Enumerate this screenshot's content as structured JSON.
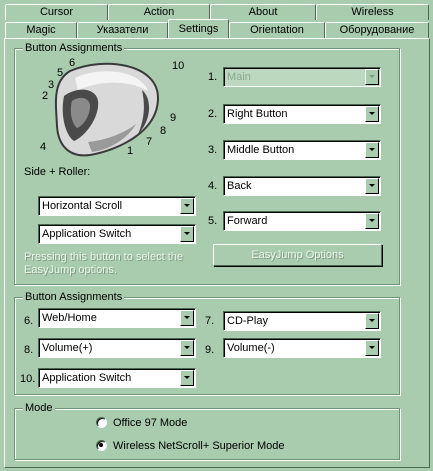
{
  "tabs_back": [
    {
      "id": "cursor",
      "label": "Cursor"
    },
    {
      "id": "action",
      "label": "Action"
    },
    {
      "id": "about",
      "label": "About"
    },
    {
      "id": "wireless",
      "label": "Wireless"
    }
  ],
  "tabs_front": [
    {
      "id": "magic",
      "label": "Magic"
    },
    {
      "id": "pointers",
      "label": "Указатели"
    },
    {
      "id": "settings",
      "label": "Settings",
      "active": true
    },
    {
      "id": "orientation",
      "label": "Orientation"
    },
    {
      "id": "hardware",
      "label": "Оборудование"
    }
  ],
  "main_group": {
    "title": "Button  Assignments",
    "callouts": [
      "1",
      "2",
      "3",
      "4",
      "5",
      "6",
      "7",
      "8",
      "9",
      "10"
    ],
    "assignments": [
      {
        "num": "1.",
        "value": "Main",
        "disabled": true
      },
      {
        "num": "2.",
        "value": "Right Button"
      },
      {
        "num": "3.",
        "value": "Middle Button"
      },
      {
        "num": "4.",
        "value": "Back"
      },
      {
        "num": "5.",
        "value": "Forward"
      }
    ],
    "side_roller_label": "Side + Roller:",
    "side_combo": "Horizontal Scroll",
    "roller_combo": "Application Switch",
    "easyjump_hint": "Pressing this button to select the EasyJump options.",
    "easyjump_button": "EasyJump Options"
  },
  "extra_group": {
    "title": "Button  Assignments",
    "assignments": [
      {
        "num": "6.",
        "value": "Web/Home"
      },
      {
        "num": "7.",
        "value": "CD-Play"
      },
      {
        "num": "8.",
        "value": "Volume(+)"
      },
      {
        "num": "9.",
        "value": "Volume(-)"
      },
      {
        "num": "10.",
        "value": "Application Switch"
      }
    ]
  },
  "mode_group": {
    "title": "Mode",
    "options": [
      {
        "label": "Office 97 Mode",
        "checked": false
      },
      {
        "label": "Wireless NetScroll+ Superior Mode",
        "checked": true
      }
    ]
  },
  "colors": {
    "background": "#a8ccad",
    "mouse_body": "#d9d9d9",
    "mouse_dark": "#4a4a4a"
  }
}
